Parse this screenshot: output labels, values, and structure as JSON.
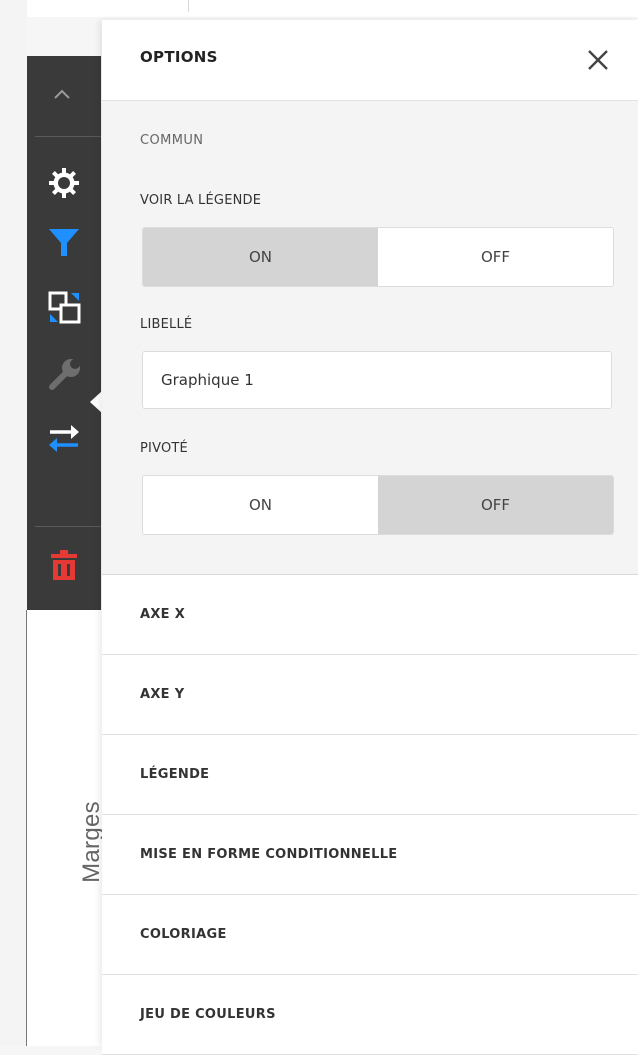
{
  "background": {
    "side_label": "Marges"
  },
  "toolbar": {
    "items": [
      {
        "icon": "chevron-up-icon"
      },
      {
        "icon": "gear-icon"
      },
      {
        "icon": "filter-icon",
        "color": "#1e90ff"
      },
      {
        "icon": "convert-item-icon"
      },
      {
        "icon": "wrench-icon",
        "active": true
      },
      {
        "icon": "swap-arrows-icon"
      },
      {
        "icon": "trash-icon",
        "color": "#e53935"
      }
    ]
  },
  "panel": {
    "title": "OPTIONS",
    "close_icon": "close-icon",
    "section_title": "COMMUN",
    "show_legend": {
      "label": "VOIR LA LÉGENDE",
      "on": "ON",
      "off": "OFF",
      "selected": "ON"
    },
    "caption": {
      "label": "LIBELLÉ",
      "value": "Graphique 1"
    },
    "rotated": {
      "label": "PIVOTÉ",
      "on": "ON",
      "off": "OFF",
      "selected": "OFF"
    },
    "sections": [
      {
        "label": "AXE X"
      },
      {
        "label": "AXE Y"
      },
      {
        "label": "LÉGENDE"
      },
      {
        "label": "MISE EN FORME CONDITIONNELLE"
      },
      {
        "label": "COLORIAGE"
      },
      {
        "label": "JEU DE COULEURS"
      }
    ]
  },
  "colors": {
    "toolbar_bg": "#3a3a3a",
    "accent_blue": "#1e90ff",
    "danger_red": "#e53935",
    "toggle_active": "#d4d4d4"
  }
}
